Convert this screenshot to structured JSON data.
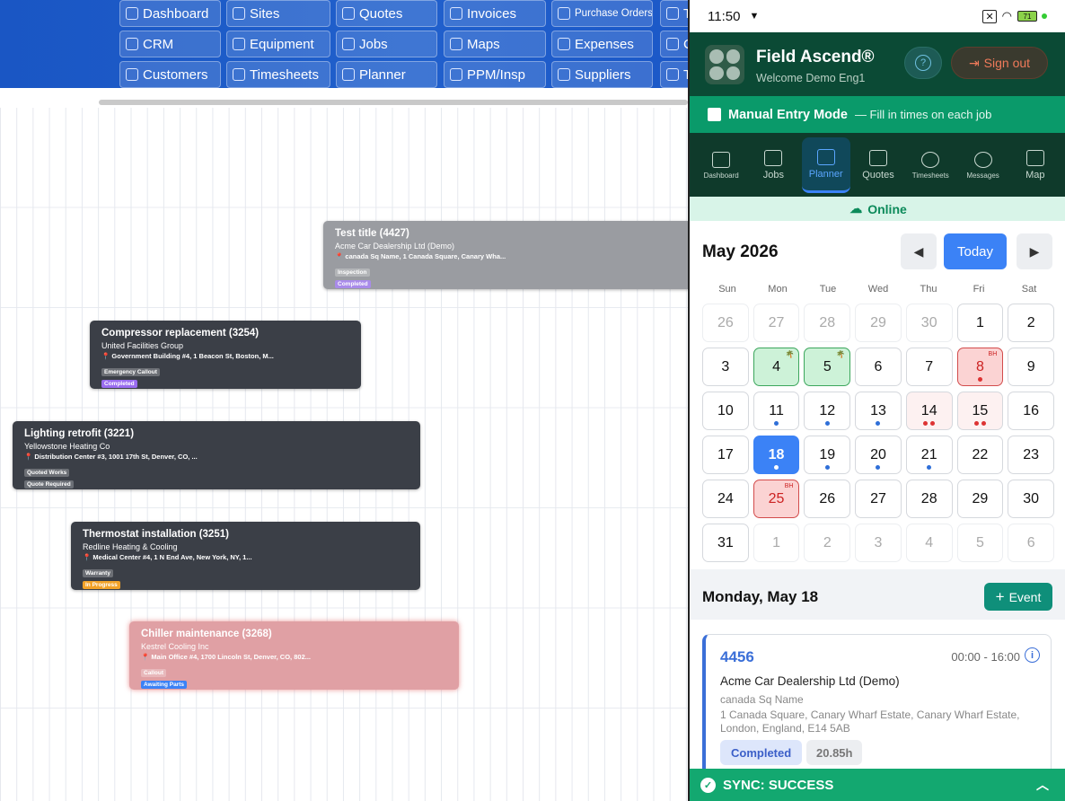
{
  "background": {
    "nav": [
      {
        "label": "Dashboard"
      },
      {
        "label": "Sites"
      },
      {
        "label": "Quotes"
      },
      {
        "label": "Invoices"
      },
      {
        "label": "Purchase Orders"
      },
      {
        "label": "T"
      },
      {
        "label": "CRM"
      },
      {
        "label": "Equipment"
      },
      {
        "label": "Jobs"
      },
      {
        "label": "Maps"
      },
      {
        "label": "Expenses"
      },
      {
        "label": "C"
      },
      {
        "label": "Customers"
      },
      {
        "label": "Timesheets"
      },
      {
        "label": "Planner"
      },
      {
        "label": "PPM/Insp"
      },
      {
        "label": "Suppliers"
      },
      {
        "label": "T"
      }
    ],
    "jobs": [
      {
        "title": "Test title (4427)",
        "customer": "Acme Car Dealership Ltd (Demo)",
        "address": "📍 canada Sq Name, 1 Canada Square, Canary Wha...",
        "tag": "Inspection",
        "status": "Completed",
        "status_color": "#a98bea",
        "bg": "#9a9ca1"
      },
      {
        "title": "Compressor replacement (3254)",
        "customer": "United Facilities Group",
        "address": "📍 Government Building #4, 1 Beacon St, Boston, M...",
        "tag": "Emergency Callout",
        "status": "Completed",
        "status_color": "#9a6cf0",
        "bg": "#3b3f47"
      },
      {
        "title": "Lighting retrofit (3221)",
        "customer": "Yellowstone Heating Co",
        "address": "📍 Distribution Center #3, 1001 17th St, Denver, CO, ...",
        "tag": "Quoted Works",
        "status": "Quote Required",
        "status_color": "#6b6f76",
        "bg": "#3b3f47"
      },
      {
        "title": "Thermostat installation (3251)",
        "customer": "Redline Heating & Cooling",
        "address": "📍 Medical Center #4, 1 N End Ave, New York, NY, 1...",
        "tag": "Warranty",
        "status": "In Progress",
        "status_color": "#f2a228",
        "bg": "#3b3f47"
      },
      {
        "title": "Chiller maintenance (3268)",
        "customer": "Kestrel Cooling Inc",
        "address": "📍 Main Office #4, 1700 Lincoln St, Denver, CO, 802...",
        "tag": "Callout",
        "status": "Awaiting Parts",
        "status_color": "#3b82f6",
        "bg": "#e0a0a4"
      }
    ]
  },
  "status_bar": {
    "time": "11:50",
    "battery": "71"
  },
  "header": {
    "brand": "Field Ascend®",
    "welcome": "Welcome Demo Eng1",
    "help_icon": "?",
    "signout": "Sign out"
  },
  "mode": {
    "title": "Manual Entry Mode",
    "subtitle": "— Fill in times on each job"
  },
  "tabs": [
    {
      "label": "Dashboard",
      "icon": "grid-icon"
    },
    {
      "label": "Jobs",
      "icon": "briefcase-icon"
    },
    {
      "label": "Planner",
      "icon": "calendar-icon",
      "active": true
    },
    {
      "label": "Quotes",
      "icon": "document-icon"
    },
    {
      "label": "Timesheets",
      "icon": "clock-icon"
    },
    {
      "label": "Messages",
      "icon": "chat-icon"
    },
    {
      "label": "Map",
      "icon": "map-icon"
    }
  ],
  "online": "Online",
  "calendar": {
    "month": "May 2026",
    "today": "Today",
    "prev": "◀",
    "next": "▶",
    "weekdays": [
      "Sun",
      "Mon",
      "Tue",
      "Wed",
      "Thu",
      "Fri",
      "Sat"
    ],
    "days": [
      {
        "d": "26",
        "out": true
      },
      {
        "d": "27",
        "out": true
      },
      {
        "d": "28",
        "out": true
      },
      {
        "d": "29",
        "out": true
      },
      {
        "d": "30",
        "out": true
      },
      {
        "d": "1"
      },
      {
        "d": "2"
      },
      {
        "d": "3"
      },
      {
        "d": "4",
        "hol": true
      },
      {
        "d": "5",
        "hol": true
      },
      {
        "d": "6"
      },
      {
        "d": "7"
      },
      {
        "d": "8",
        "bh": true,
        "dots": [
          "r"
        ]
      },
      {
        "d": "9"
      },
      {
        "d": "10"
      },
      {
        "d": "11",
        "dots": [
          "b"
        ]
      },
      {
        "d": "12",
        "dots": [
          "b"
        ]
      },
      {
        "d": "13",
        "dots": [
          "b"
        ]
      },
      {
        "d": "14",
        "lt": true,
        "dots": [
          "r",
          "r"
        ]
      },
      {
        "d": "15",
        "lt": true,
        "dots": [
          "r",
          "r"
        ]
      },
      {
        "d": "16"
      },
      {
        "d": "17"
      },
      {
        "d": "18",
        "sel": true,
        "dots": [
          "w"
        ]
      },
      {
        "d": "19",
        "dots": [
          "b"
        ]
      },
      {
        "d": "20",
        "dots": [
          "b"
        ]
      },
      {
        "d": "21",
        "dots": [
          "b"
        ]
      },
      {
        "d": "22"
      },
      {
        "d": "23"
      },
      {
        "d": "24"
      },
      {
        "d": "25",
        "bh": true
      },
      {
        "d": "26"
      },
      {
        "d": "27"
      },
      {
        "d": "28"
      },
      {
        "d": "29"
      },
      {
        "d": "30"
      },
      {
        "d": "31"
      },
      {
        "d": "1",
        "out": true
      },
      {
        "d": "2",
        "out": true
      },
      {
        "d": "3",
        "out": true
      },
      {
        "d": "4",
        "out": true
      },
      {
        "d": "5",
        "out": true
      },
      {
        "d": "6",
        "out": true
      }
    ],
    "bh_label": "BH"
  },
  "selected": {
    "title": "Monday, May 18",
    "add_event": "Event"
  },
  "job_card": {
    "number": "4456",
    "time": "00:00 - 16:00",
    "customer": "Acme Car Dealership Ltd (Demo)",
    "site": "canada Sq Name",
    "address": "1 Canada Square, Canary Wharf Estate, Canary Wharf Estate, London, England, E14 5AB",
    "status": "Completed",
    "hours": "20.85h"
  },
  "sync": "SYNC: SUCCESS"
}
